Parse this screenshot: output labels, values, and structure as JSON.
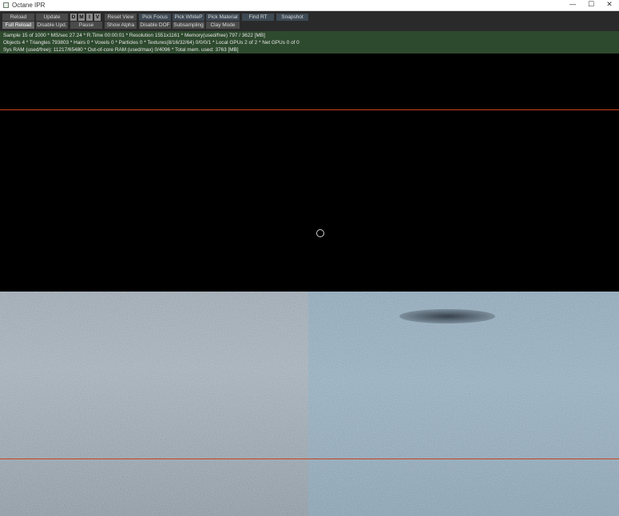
{
  "window": {
    "title": "Octane IPR",
    "controls": {
      "minimize": "—",
      "maximize": "☐",
      "close": "✕"
    }
  },
  "toolbar": {
    "row1": [
      "Reload",
      "Update",
      "D",
      "M",
      "I",
      "V",
      "Reset View",
      "Pick Focus",
      "Pick WhiteP",
      "Pick Material",
      "Find RT",
      "Snapshot"
    ],
    "row2": [
      "Full Reload",
      "Disable Upd.",
      "Pause",
      "Show Alpha",
      "Disable DOF",
      "Subsampling",
      "Clay Mode"
    ]
  },
  "status": {
    "line1": "Sample 15 of 1000 * MS/sec 27.24 * R.Time 00:00:01 * Resolution 1551x1161 * Memory(used/free) 797 / 3622 [MB]",
    "line2": "Objects 4 * Triangles 793803 * Hairs 0 * Voxels 0 * Particles 0 * Textures(8/16/32/64) 0/0/0/1 * Local GPUs 2 of 2 * Net GPUs 0 of 0",
    "line3": "Sys RAM (used/free): 11217/65480 * Out-of-core RAM (used/max) 0/4096 * Total mem. used: 3763 [MB]"
  },
  "colors": {
    "toolbar_bg": "#2a2a2a",
    "status_bg": "#2e4a2e",
    "guide_line": "#c8441c",
    "floor_left": "#8e9ba6",
    "floor_right": "#7f9aad"
  }
}
